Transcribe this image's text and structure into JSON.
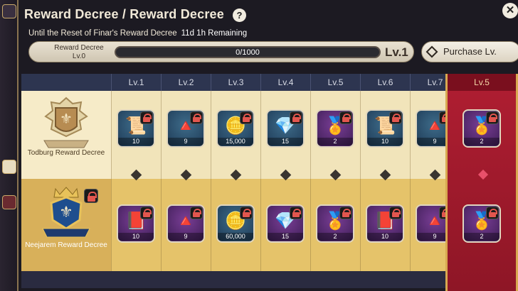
{
  "header": {
    "title": "Reward Decree / Reward Decree",
    "help_symbol": "?",
    "close_symbol": "✕",
    "reset_label": "Until the Reset of Finar's Reward Decree",
    "reset_remaining": "11d 1h Remaining"
  },
  "progress": {
    "label_line1": "Reward Decree",
    "label_line2": "Lv.0",
    "value_text": "0/1000",
    "fraction": 0,
    "level_text": "Lv.1"
  },
  "purchase_button": {
    "label": "Purchase Lv."
  },
  "levels": [
    "Lv.1",
    "Lv.2",
    "Lv.3",
    "Lv.4",
    "Lv.5",
    "Lv.6",
    "Lv.7"
  ],
  "featured": {
    "level": "Lv.5",
    "top_qty": "2",
    "bottom_qty": "2"
  },
  "tracks": {
    "free": {
      "name": "Todburg Reward Decree",
      "items": [
        {
          "qty": "10",
          "style": "blue",
          "icon": "scroll-icon"
        },
        {
          "qty": "9",
          "style": "blue",
          "icon": "pyramid-icon"
        },
        {
          "qty": "15,000",
          "style": "blue",
          "icon": "coins-icon"
        },
        {
          "qty": "15",
          "style": "blue",
          "icon": "crystal-icon"
        },
        {
          "qty": "2",
          "style": "purple",
          "icon": "medal-icon"
        },
        {
          "qty": "10",
          "style": "blue",
          "icon": "scroll-icon"
        },
        {
          "qty": "9",
          "style": "blue",
          "icon": "pyramid-icon"
        }
      ]
    },
    "premium": {
      "name": "Neejarem Reward Decree",
      "items": [
        {
          "qty": "10",
          "style": "purple",
          "icon": "book-icon"
        },
        {
          "qty": "9",
          "style": "purple",
          "icon": "pyramid-icon"
        },
        {
          "qty": "60,000",
          "style": "blue",
          "icon": "coins-icon"
        },
        {
          "qty": "15",
          "style": "purple",
          "icon": "crystal-icon"
        },
        {
          "qty": "2",
          "style": "purple",
          "icon": "medal-icon"
        },
        {
          "qty": "10",
          "style": "purple",
          "icon": "book-icon"
        },
        {
          "qty": "9",
          "style": "purple",
          "icon": "pyramid-icon"
        }
      ]
    }
  },
  "colors": {
    "accent_gold": "#d2a653",
    "featured_red": "#b01e32",
    "lock_red": "#e2564e"
  }
}
